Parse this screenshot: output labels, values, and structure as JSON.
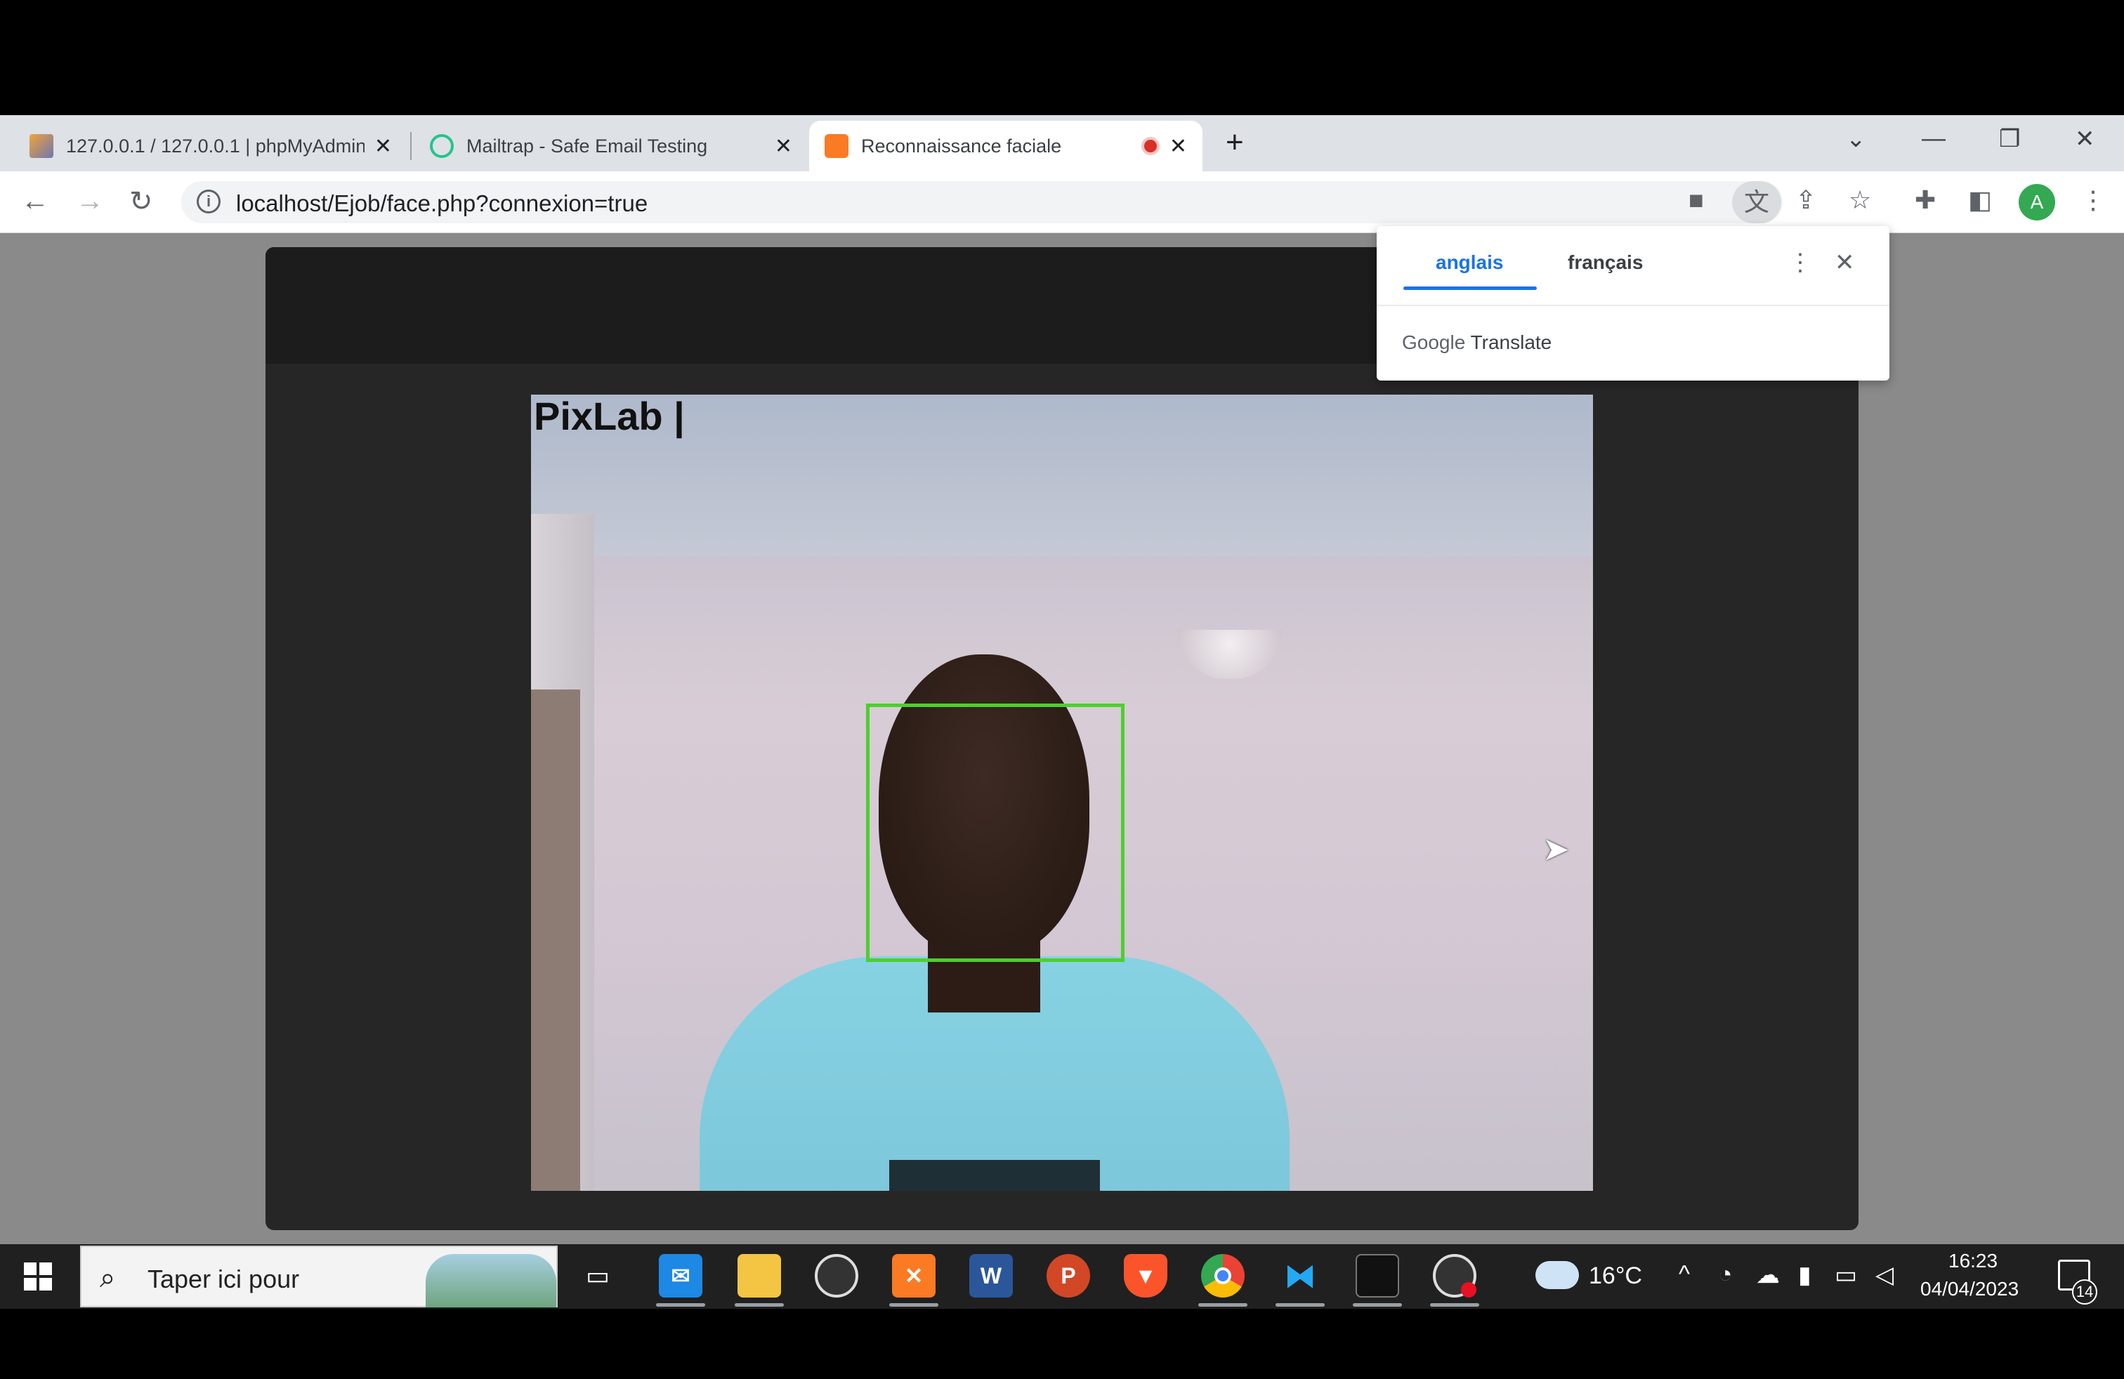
{
  "browser": {
    "tabs": [
      {
        "title": "127.0.0.1 / 127.0.0.1 | phpMyAdmin",
        "favicon": "phpmyadmin-icon",
        "active": false
      },
      {
        "title": "Mailtrap - Safe Email Testing",
        "favicon": "mailtrap-icon",
        "active": false
      },
      {
        "title": "Reconnaissance faciale",
        "favicon": "xampp-icon",
        "active": true,
        "recording": true
      }
    ],
    "new_tab_label": "+",
    "url": "localhost/Ejob/face.php?connexion=true",
    "profile_initial": "A",
    "accent_color": "#1a73e8"
  },
  "translate_popup": {
    "source_language": "anglais",
    "target_language": "français",
    "brand_google": "Google",
    "brand_translate": "Translate"
  },
  "page": {
    "camera_overlay_text": "PixLab |",
    "face_box_color": "#4fce2f"
  },
  "taskbar": {
    "search_placeholder": "Taper ici pour",
    "weather": "16°C",
    "time": "16:23",
    "date": "04/04/2023",
    "notification_count": "14",
    "apps": [
      "task-view",
      "mail",
      "file-explorer",
      "obs",
      "xampp",
      "word",
      "powerpoint",
      "brave",
      "chrome",
      "vscode",
      "terminal",
      "obs-recording"
    ]
  }
}
